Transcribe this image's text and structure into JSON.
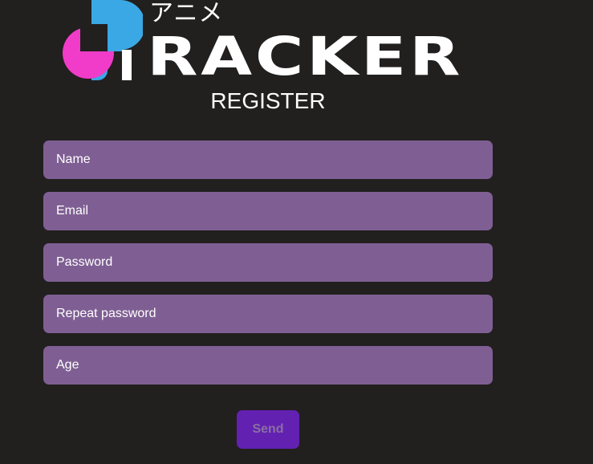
{
  "logo": {
    "kana": "アニメ",
    "word": "RACKER",
    "colors": {
      "pink": "#f03cc8",
      "blue": "#3aa8e4",
      "white": "#ffffff"
    }
  },
  "form": {
    "title": "REGISTER",
    "fields": [
      {
        "placeholder": "Name",
        "value": ""
      },
      {
        "placeholder": "Email",
        "value": ""
      },
      {
        "placeholder": "Password",
        "value": ""
      },
      {
        "placeholder": "Repeat password",
        "value": ""
      },
      {
        "placeholder": "Age",
        "value": ""
      }
    ],
    "submit_label": "Send"
  },
  "colors": {
    "background": "#221f1f",
    "field_bg": "#7f5f93",
    "button_bg": "#6321b2",
    "button_text": "#8a6fa3"
  }
}
